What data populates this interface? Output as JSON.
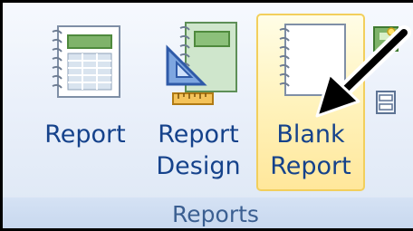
{
  "ribbon": {
    "group_label": "Reports",
    "buttons": [
      {
        "line1": "Report",
        "line2": "",
        "icon": "report-icon"
      },
      {
        "line1": "Report",
        "line2": "Design",
        "icon": "report-design-icon"
      },
      {
        "line1": "Blank",
        "line2": "Report",
        "icon": "blank-report-icon",
        "state": "hovered"
      }
    ]
  },
  "colors": {
    "label_text": "#15428b",
    "group_text": "#3b5f91",
    "highlight_border": "#f2cf5c",
    "highlight_fill": "#fff3bd"
  }
}
